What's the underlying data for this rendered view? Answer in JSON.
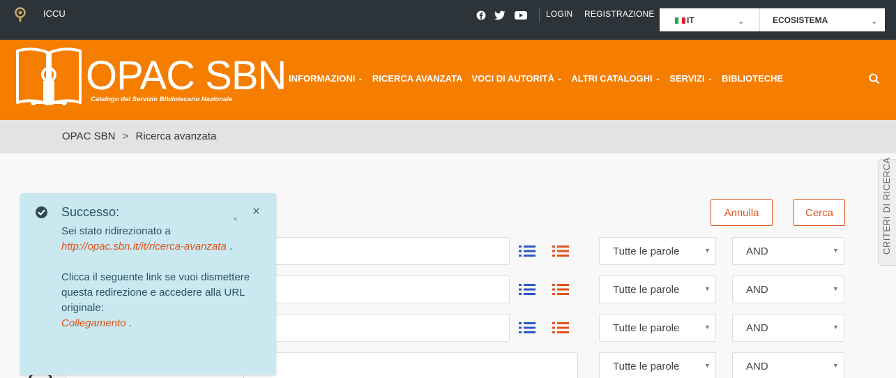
{
  "topbar": {
    "brand": "ICCU",
    "login": "LOGIN",
    "register": "REGISTRAZIONE",
    "language": "IT",
    "ecosystem": "ECOSISTEMA"
  },
  "header": {
    "title": "OPAC SBN",
    "subtitle": "Catalogo del Servizio Bibliotecario Nazionale",
    "nav": [
      {
        "label": "INFORMAZIONI",
        "caret": true
      },
      {
        "label": "RICERCA AVANZATA",
        "caret": false
      },
      {
        "label": "VOCI DI AUTORITÀ",
        "caret": true
      },
      {
        "label": "ALTRI CATALOGHI",
        "caret": true
      },
      {
        "label": "SERVIZI",
        "caret": true
      },
      {
        "label": "BIBLIOTECHE",
        "caret": false
      }
    ]
  },
  "breadcrumb": {
    "home": "OPAC SBN",
    "separator": ">",
    "current": "Ricerca avanzata"
  },
  "actions": {
    "cancel": "Annulla",
    "search": "Cerca"
  },
  "side_tab": "CRITERI DI RICERCA",
  "rows": [
    {
      "match": "Tutte le parole",
      "operator": "AND"
    },
    {
      "match": "Tutte le parole",
      "operator": "AND"
    },
    {
      "match": "Tutte le parole",
      "operator": "AND"
    },
    {
      "match": "Tutte le parole",
      "operator": "AND"
    }
  ],
  "notification": {
    "title": "Successo:",
    "line1": "Sei stato ridirezionato a",
    "link_url": "http://opac.sbn.it/it/ricerca-avanzata",
    "after_link": ".",
    "line2": "Clicca il seguente link se vuoi dismettere questa redirezione e accedere alla URL originale:",
    "link_label": "Collegamento",
    "after_link2": ".",
    "small_close": "×",
    "close": "×"
  },
  "colors": {
    "topbar": "#2c3339",
    "orange": "#f57d00",
    "accent": "#e0521c",
    "list_blue": "#2a56c6",
    "toast_bg": "#c9e8ef"
  },
  "icons": [
    "logo-icon",
    "facebook-icon",
    "twitter-icon",
    "youtube-icon",
    "flag-icon",
    "chevron-down-icon",
    "book-logo-icon",
    "search-icon",
    "list-icon",
    "check-circle-icon",
    "close-icon"
  ]
}
